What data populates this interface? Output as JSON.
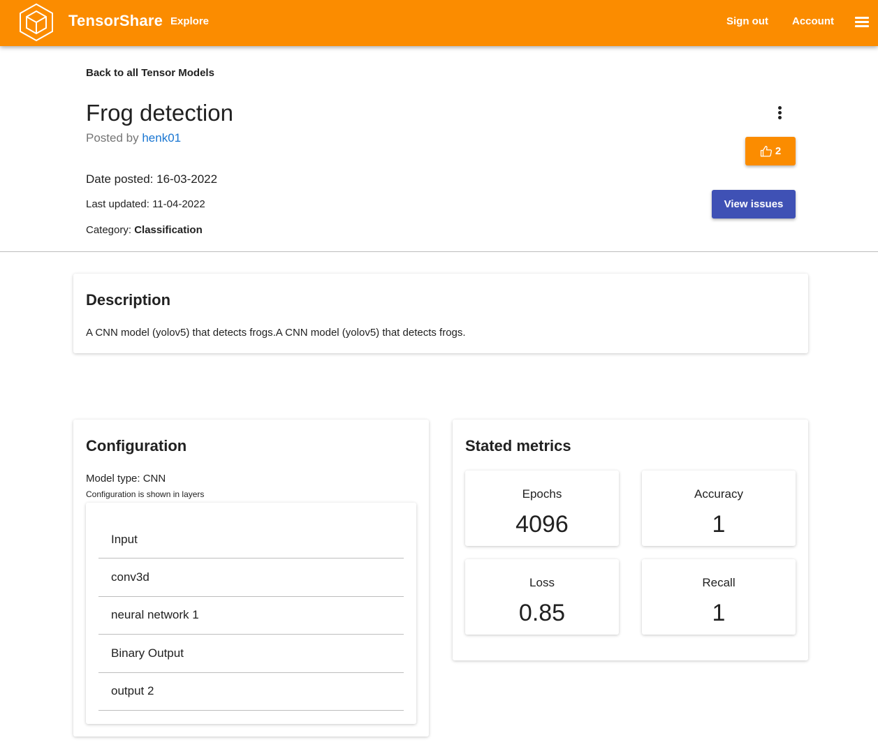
{
  "header": {
    "brand": "TensorShare",
    "nav": {
      "explore": "Explore",
      "sign_out": "Sign out",
      "account": "Account"
    },
    "icons": {
      "logo": "hexagon-cube-logo",
      "menu": "hamburger-menu-icon"
    },
    "accent_color": "#fb8c00"
  },
  "page": {
    "back_link": "Back to all Tensor Models",
    "title": "Frog detection",
    "posted_by_prefix": "Posted by",
    "author": "henk01",
    "date_posted": "Date posted: 16-03-2022",
    "last_updated": "Last updated: 11-04-2022",
    "category_prefix": "Category:",
    "category": "Classification",
    "like_count": "2",
    "view_issues_label": "View issues",
    "view_issues_color": "#3f51b5"
  },
  "description": {
    "title": "Description",
    "text": "A CNN model (yolov5) that detects frogs.A CNN model (yolov5) that detects frogs."
  },
  "configuration": {
    "title": "Configuration",
    "model_type": "Model type: CNN",
    "note": "Configuration is shown in layers",
    "layers": [
      "Input",
      "conv3d",
      "neural network 1",
      "Binary Output",
      "output 2"
    ]
  },
  "metrics": {
    "title": "Stated metrics",
    "items": [
      {
        "label": "Epochs",
        "value": "4096"
      },
      {
        "label": "Accuracy",
        "value": "1"
      },
      {
        "label": "Loss",
        "value": "0.85"
      },
      {
        "label": "Recall",
        "value": "1"
      }
    ]
  }
}
